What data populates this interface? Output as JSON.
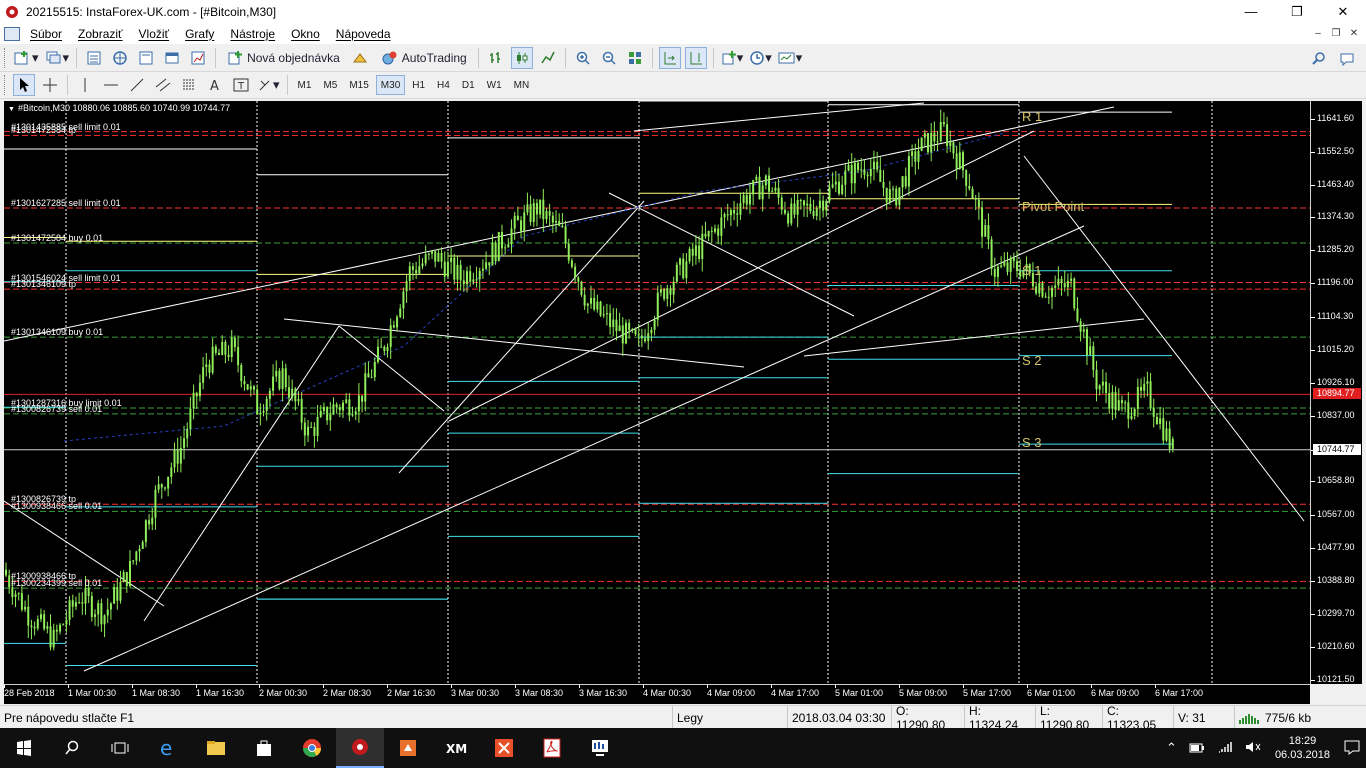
{
  "window": {
    "title": "20215515: InstaForex-UK.com - [#Bitcoin,M30]",
    "controls": {
      "minimize": "—",
      "maximize": "❐",
      "close": "✕"
    }
  },
  "menu": {
    "items": [
      "Súbor",
      "Zobraziť",
      "Vložiť",
      "Grafy",
      "Nástroje",
      "Okno",
      "Nápoveda"
    ],
    "mdi_controls": [
      "‒",
      "❐",
      "✕"
    ]
  },
  "toolbar1": {
    "new_order_label": "Nová objednávka",
    "autotrading_label": "AutoTrading",
    "icons": [
      "new-chart-icon",
      "profiles-icon",
      "market-watch-icon",
      "navigator-icon",
      "data-window-icon",
      "terminal-icon",
      "new-order-icon",
      "expert-icon",
      "autotrading-icon",
      "bar-chart-icon",
      "candlestick-icon",
      "line-chart-icon",
      "zoom-in-icon",
      "zoom-out-icon",
      "tile-windows-icon",
      "auto-scroll-icon",
      "chart-shift-icon",
      "indicators-icon",
      "periods-icon",
      "templates-icon",
      "search-icon",
      "chat-icon"
    ]
  },
  "toolbar2": {
    "tools": [
      "cursor-icon",
      "crosshair-icon",
      "vertical-line-icon",
      "horizontal-line-icon",
      "trendline-icon",
      "equidistant-channel-icon",
      "fibonacci-icon",
      "text-icon",
      "text-label-icon",
      "arrows-icon"
    ],
    "timeframes": [
      "M1",
      "M5",
      "M15",
      "M30",
      "H1",
      "H4",
      "D1",
      "W1",
      "MN"
    ],
    "active_timeframe": "M30"
  },
  "chart_info": {
    "symbol_line": "#Bitcoin,M30  10880.06 10885.60 10740.99 10744.77"
  },
  "order_labels": [
    {
      "text": "#1301435885 sell limit 0.01",
      "price": 11607
    },
    {
      "text": "#1301472584 tp",
      "price": 11597
    },
    {
      "text": "#1301627285 sell limit 0.01",
      "price": 11400
    },
    {
      "text": "#1301472584 buy 0.01",
      "price": 11305
    },
    {
      "text": "#1301546024 sell limit 0.01",
      "price": 11198
    },
    {
      "text": "#1301346109 tp",
      "price": 11180
    },
    {
      "text": "#1301346109 buy 0.01",
      "price": 11050
    },
    {
      "text": "#1301287316 buy limit 0.01",
      "price": 10858
    },
    {
      "text": "#1300826739 sell 0.01",
      "price": 10842
    },
    {
      "text": "#1300826739 tp",
      "price": 10597
    },
    {
      "text": "#1300938466 sell 0.01",
      "price": 10578
    },
    {
      "text": "#1300938466 tp",
      "price": 10388
    },
    {
      "text": "#1300234399 sell 0.01",
      "price": 10370
    }
  ],
  "pivot_labels": [
    {
      "text": "R 1",
      "price": 11630
    },
    {
      "text": "Pivot Point",
      "price": 11386
    },
    {
      "text": "S 1",
      "price": 11214
    },
    {
      "text": "S 2",
      "price": 10968
    },
    {
      "text": "S 3",
      "price": 10748
    }
  ],
  "price_axis": {
    "ticks": [
      "11641.60",
      "11552.50",
      "11463.40",
      "11374.30",
      "11285.20",
      "11196.00",
      "11104.30",
      "11015.20",
      "10926.10",
      "10837.00",
      "10744.77",
      "10658.80",
      "10567.00",
      "10477.90",
      "10388.80",
      "10299.70",
      "10210.60",
      "10121.50"
    ],
    "current_price": "10744.77",
    "red_line_price": "10894.77",
    "range": [
      10110,
      11690
    ]
  },
  "time_axis": {
    "labels": [
      "28 Feb 2018",
      "1 Mar 00:30",
      "1 Mar 08:30",
      "1 Mar 16:30",
      "2 Mar 00:30",
      "2 Mar 08:30",
      "2 Mar 16:30",
      "3 Mar 00:30",
      "3 Mar 08:30",
      "3 Mar 16:30",
      "4 Mar 00:30",
      "4 Mar 09:00",
      "4 Mar 17:00",
      "5 Mar 01:00",
      "5 Mar 09:00",
      "5 Mar 17:00",
      "6 Mar 01:00",
      "6 Mar 09:00",
      "6 Mar 17:00"
    ]
  },
  "chart_data": {
    "type": "candlestick",
    "symbol": "#Bitcoin",
    "timeframe": "M30",
    "last_bar": {
      "open": 10880.06,
      "high": 10885.6,
      "low": 10740.99,
      "close": 10744.77
    },
    "ylim": [
      10110,
      11690
    ],
    "price_path": [
      10420,
      10300,
      10230,
      10350,
      10300,
      10420,
      10620,
      10750,
      10980,
      11020,
      10860,
      10950,
      10790,
      10860,
      10880,
      11030,
      11230,
      11270,
      11210,
      11260,
      11340,
      11400,
      11330,
      11140,
      11080,
      11030,
      11180,
      11260,
      11340,
      11420,
      11470,
      11380,
      11410,
      11480,
      11520,
      11420,
      11560,
      11610,
      11470,
      11230,
      11240,
      11180,
      11190,
      10930,
      10850,
      10900,
      10745
    ],
    "colors": {
      "up": "#90ee5a",
      "down": "#90ee5a",
      "background": "#000000",
      "grid": "#ffffff",
      "order_line": "#ff3030",
      "pivot_line": "#ffff80",
      "support_line": "#40e0f0"
    }
  },
  "statusbar": {
    "help": "Pre nápovedu stlačte F1",
    "profile": "Legy",
    "datetime": "2018.03.04 03:30",
    "open": "O: 11290.80",
    "high": "H: 11324.24",
    "low": "L: 11290.80",
    "close": "C: 11323.05",
    "volume": "V: 31",
    "traffic": "775/6 kb"
  },
  "taskbar": {
    "icons": [
      "windows-start-icon",
      "search-icon",
      "task-view-icon",
      "edge-icon",
      "file-explorer-icon",
      "store-icon",
      "chrome-icon",
      "instaforex-icon",
      "app-icon",
      "xm-icon",
      "x-app-icon",
      "pdf-icon",
      "mt4-icon"
    ],
    "time": "18:29",
    "date": "06.03.2018"
  }
}
